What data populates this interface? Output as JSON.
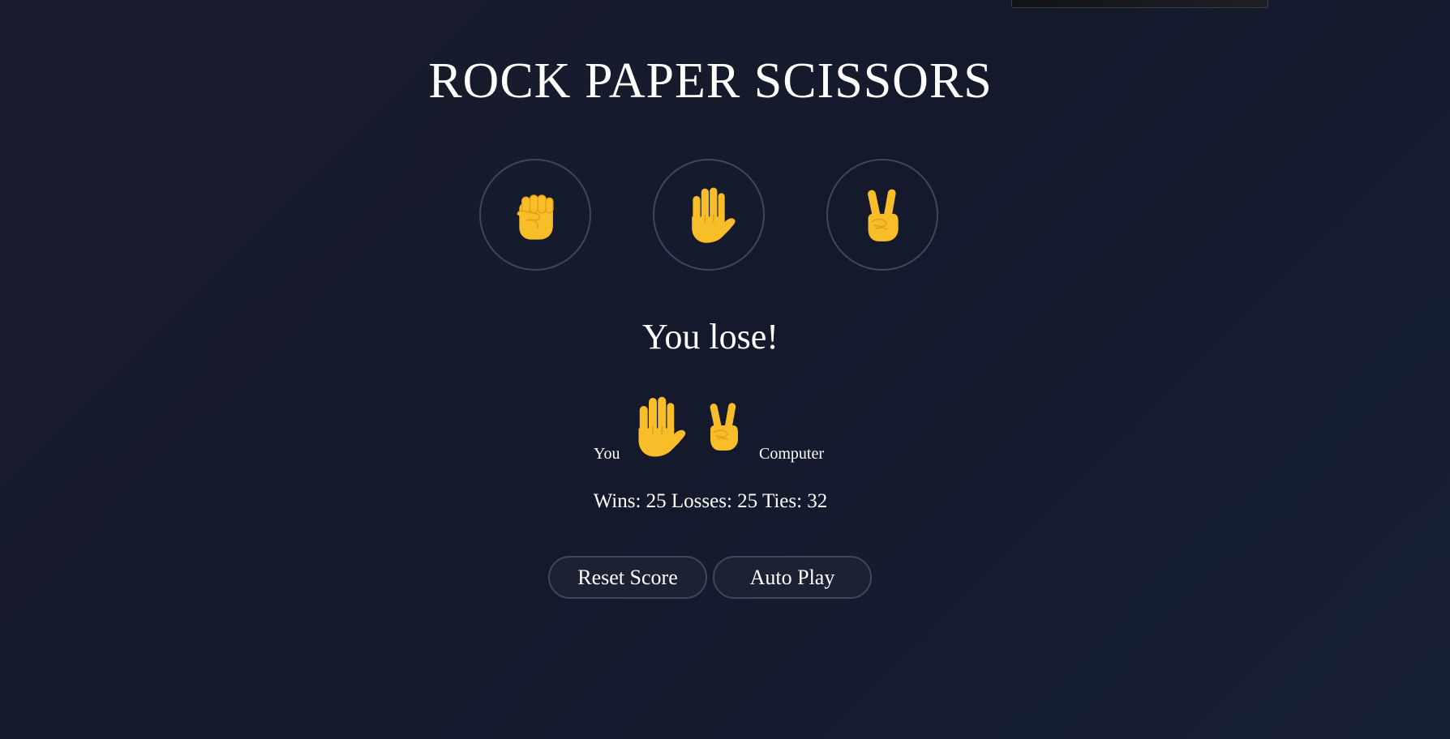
{
  "game": {
    "title": "ROCK PAPER SCISSORS",
    "moves": [
      {
        "name": "rock",
        "icon": "raised-fist-emoji"
      },
      {
        "name": "paper",
        "icon": "raised-hand-emoji"
      },
      {
        "name": "scissors",
        "icon": "victory-hand-emoji"
      }
    ],
    "result_text": "You lose!",
    "player_label": "You",
    "computer_label": "Computer",
    "player_move_icon": "raised-hand-emoji",
    "computer_move_icon": "victory-hand-emoji",
    "score_text": "Wins: 25 Losses: 25 Ties: 32",
    "score": {
      "wins": 25,
      "losses": 25,
      "ties": 32
    }
  },
  "controls": {
    "reset_label": "Reset Score",
    "autoplay_label": "Auto Play"
  },
  "colors": {
    "background": "#171c2d",
    "emoji_yellow": "#f7be2a",
    "emoji_shade": "#e39f18",
    "circle_border": "#40465e",
    "button_fill": "#1c2232"
  }
}
